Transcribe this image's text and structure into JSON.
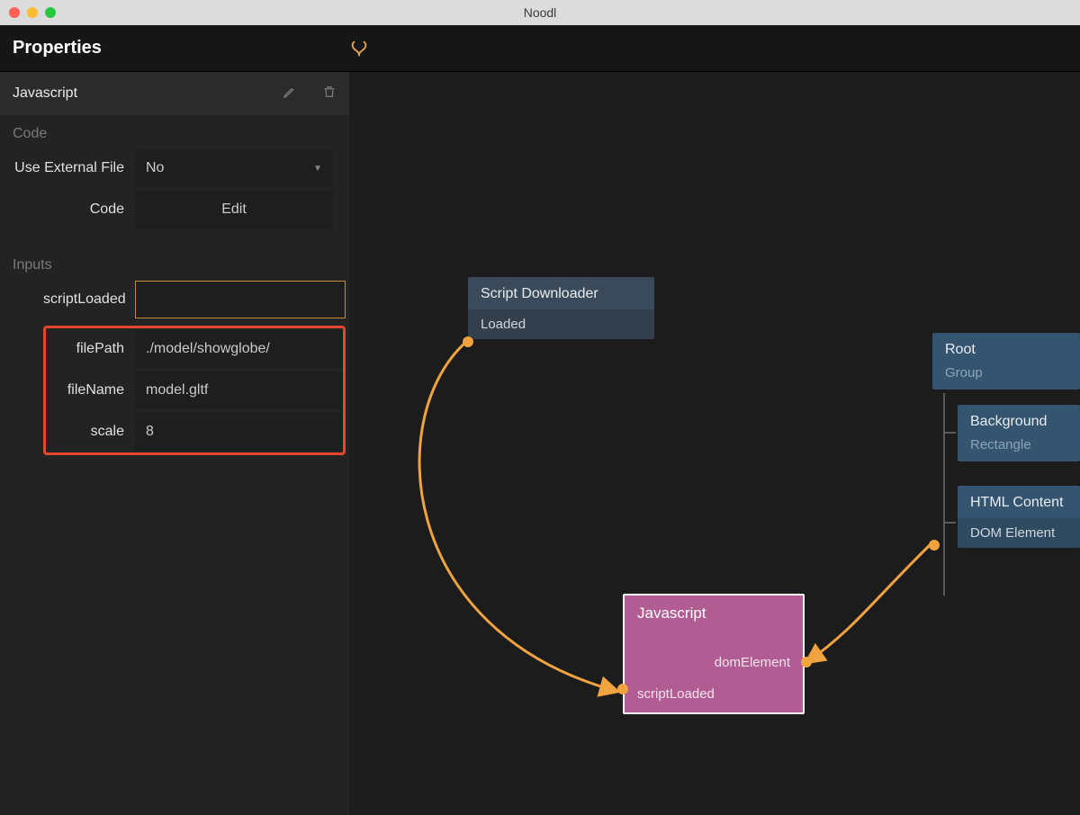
{
  "window": {
    "title": "Noodl"
  },
  "header": {
    "title": "Properties"
  },
  "panel": {
    "name": "Javascript",
    "sections": {
      "code": {
        "label": "Code",
        "useExternalFile": {
          "label": "Use External File",
          "value": "No"
        },
        "codeRow": {
          "label": "Code",
          "button": "Edit"
        }
      },
      "inputs": {
        "label": "Inputs",
        "scriptLoaded": {
          "label": "scriptLoaded",
          "value": ""
        },
        "filePath": {
          "label": "filePath",
          "value": "./model/showglobe/"
        },
        "fileName": {
          "label": "fileName",
          "value": "model.gltf"
        },
        "scale": {
          "label": "scale",
          "value": "8"
        }
      }
    }
  },
  "canvas": {
    "scriptDownloader": {
      "title": "Script Downloader",
      "port": "Loaded"
    },
    "root": {
      "title": "Root",
      "subtitle": "Group"
    },
    "background": {
      "title": "Background",
      "subtitle": "Rectangle"
    },
    "htmlContent": {
      "title": "HTML Content",
      "port": "DOM Element"
    },
    "javascript": {
      "title": "Javascript",
      "portRight": "domElement",
      "portLeft": "scriptLoaded"
    }
  }
}
